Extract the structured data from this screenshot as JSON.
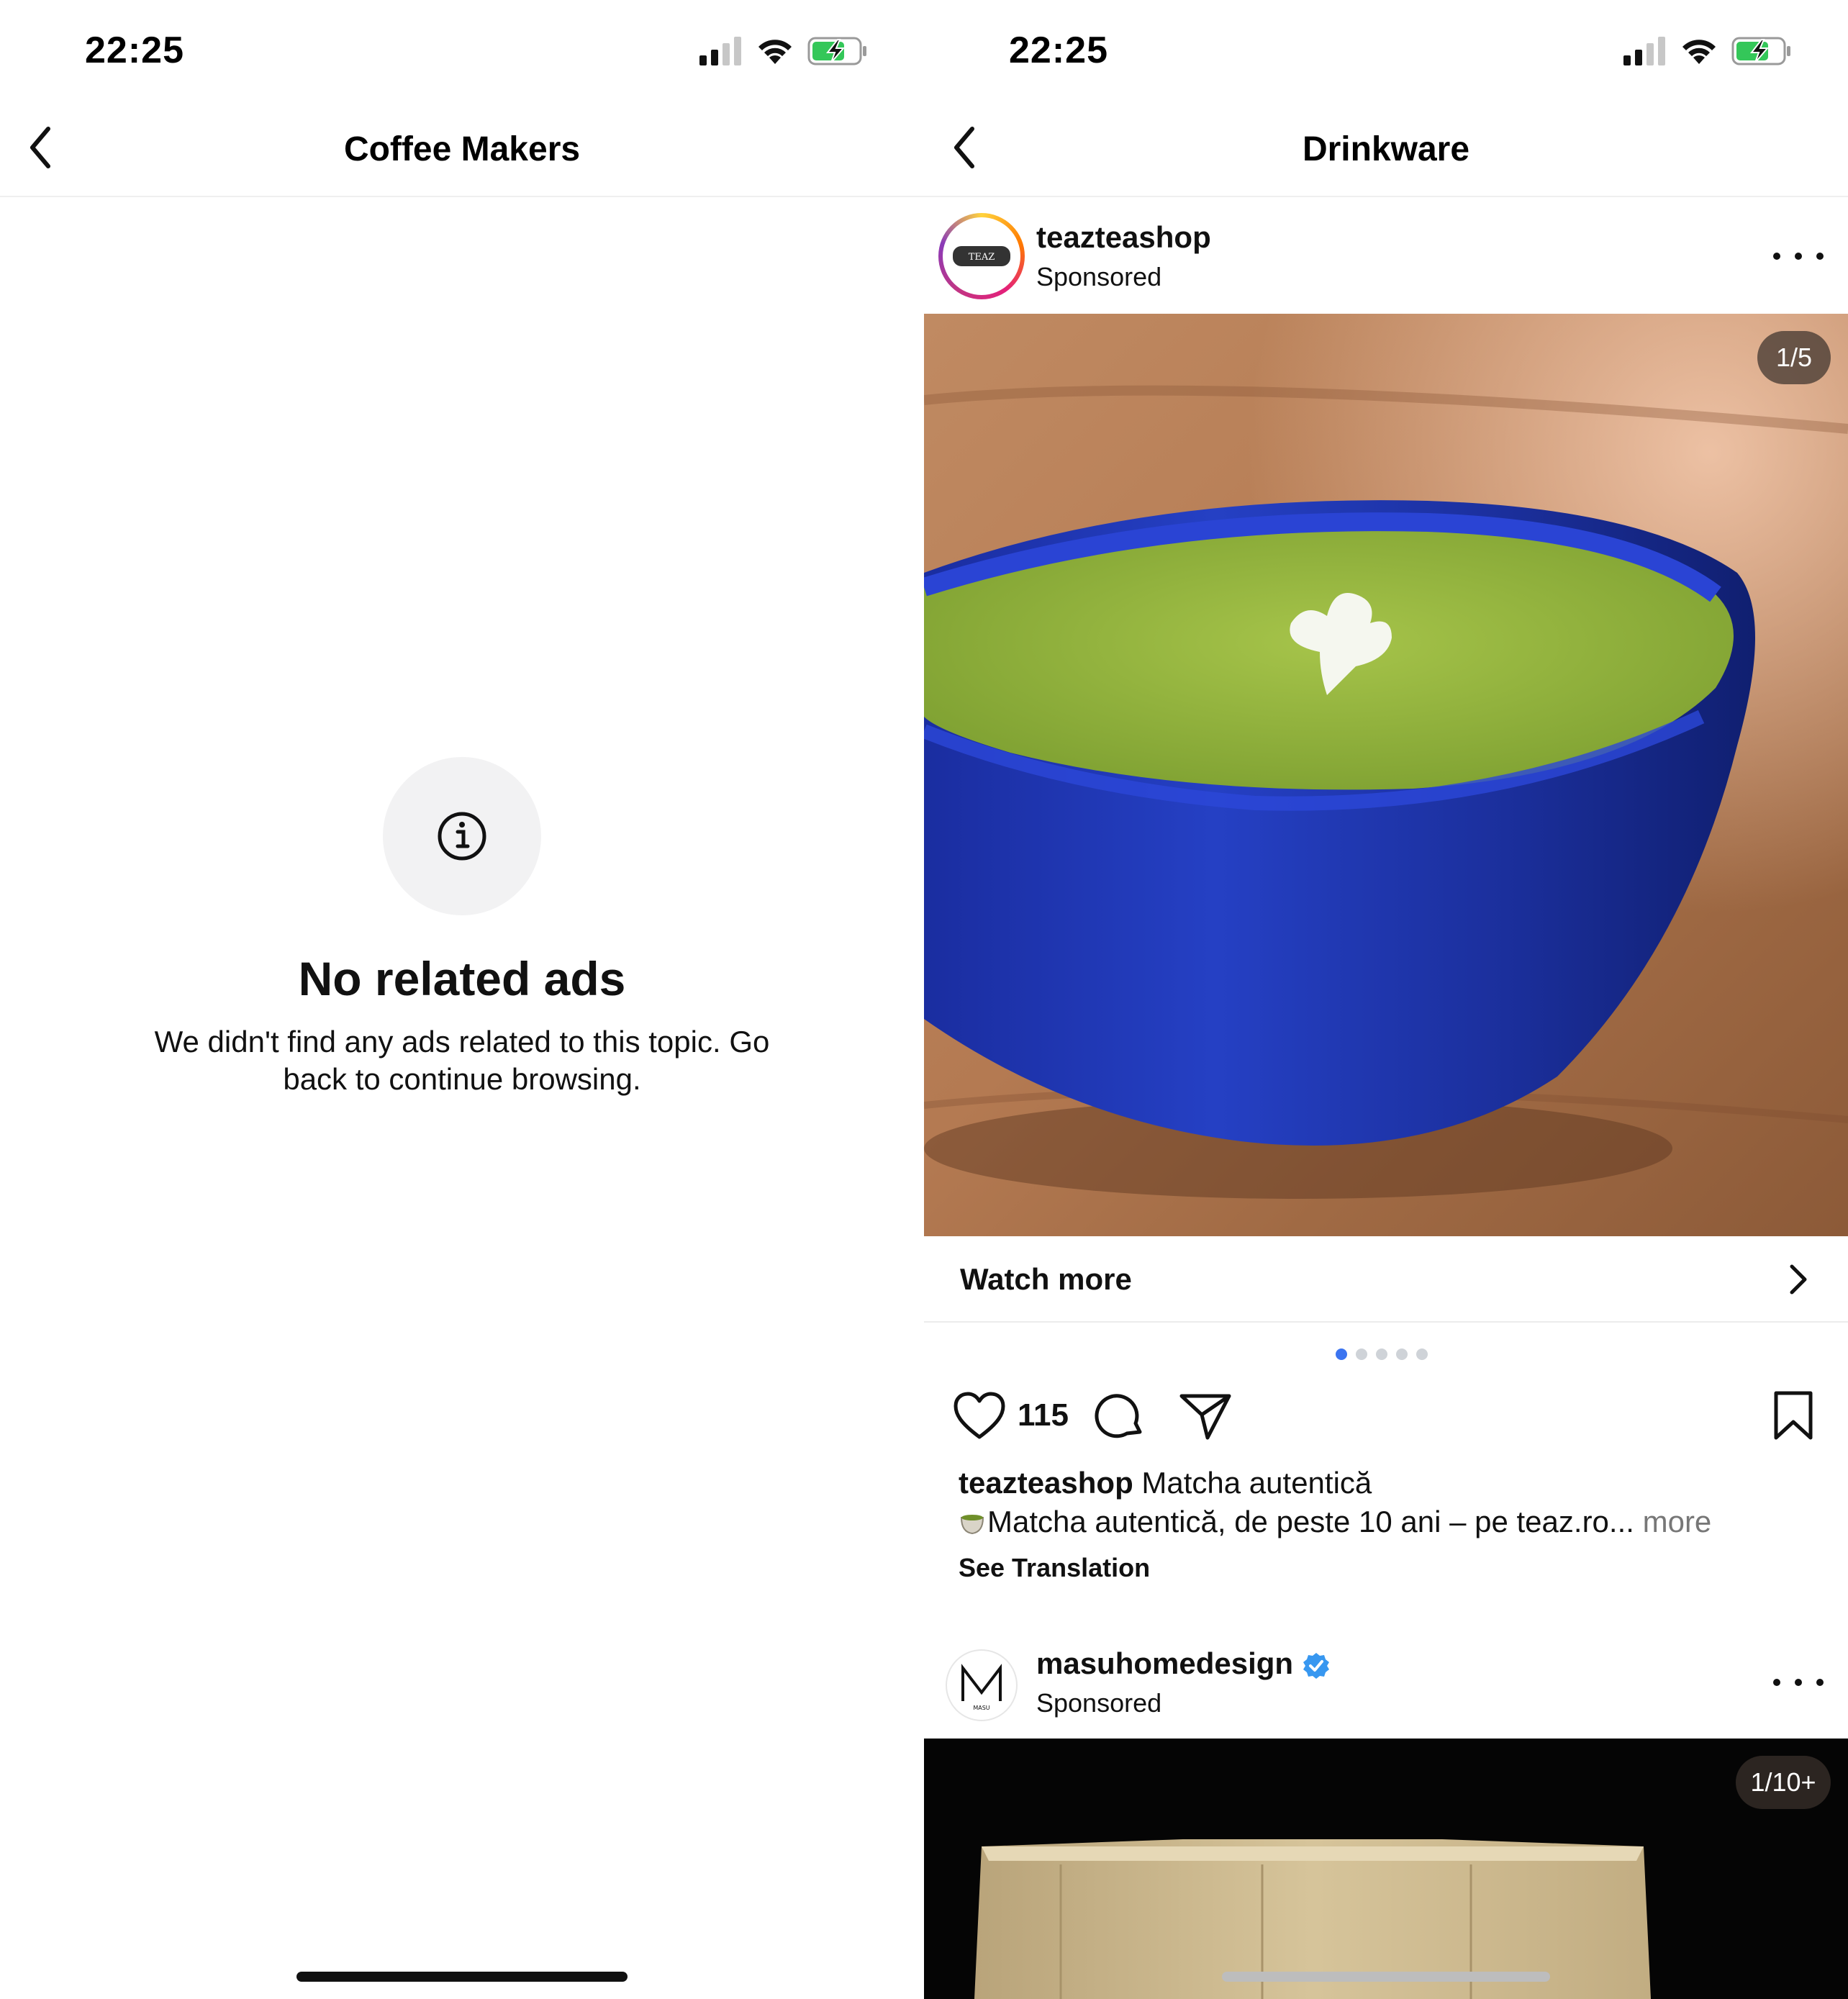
{
  "left": {
    "status_time": "22:25",
    "nav_title": "Coffee Makers",
    "empty_title": "No related ads",
    "empty_description": "We didn't find any ads related to this topic. Go back to continue browsing.",
    "icons": {
      "back": "chevron-left-icon",
      "info": "info-icon"
    }
  },
  "right": {
    "status_time": "22:25",
    "nav_title": "Drinkware",
    "post1": {
      "account": "teazteashop",
      "sponsored_label": "Sponsored",
      "media_counter": "1/5",
      "cta_label": "Watch more",
      "carousel_total": 5,
      "carousel_active": 1,
      "likes": "115",
      "caption_user": "teazteashop",
      "caption_title": "Matcha autentică",
      "caption_line2": "Matcha autentică, de peste 10 ani – pe teaz.ro...",
      "caption_more": "more",
      "see_translation": "See Translation",
      "avatar_text": "TEAZ"
    },
    "post2": {
      "account": "masuhomedesign",
      "verified": true,
      "sponsored_label": "Sponsored",
      "media_counter": "1/10+",
      "avatar_text": "MASU"
    }
  },
  "colors": {
    "carousel_active": "#3b74f0",
    "verified_badge": "#3797f0",
    "battery_charge": "#34c759"
  }
}
